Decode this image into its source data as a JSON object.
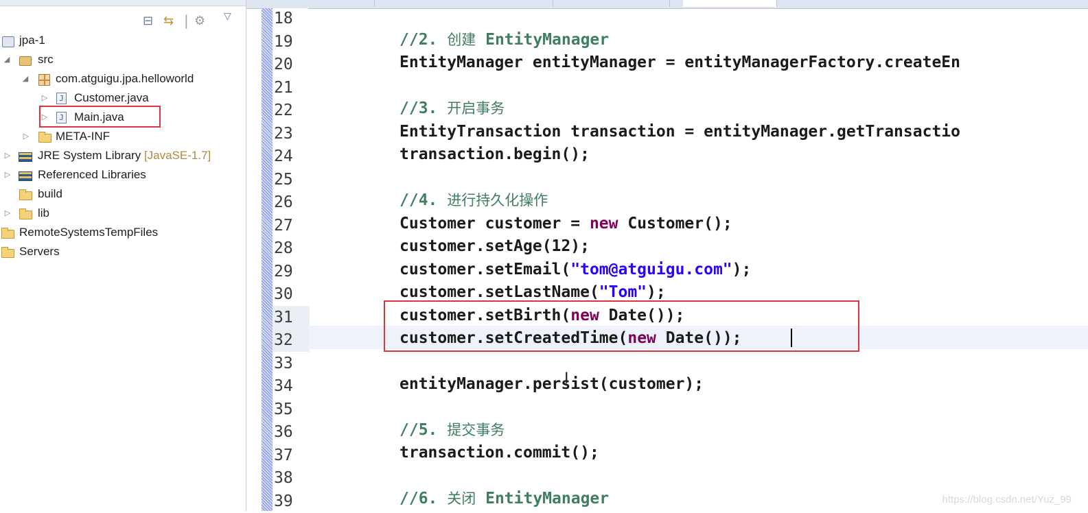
{
  "explorer": {
    "tree": [
      {
        "label": "jpa-1",
        "decoration": "",
        "icon": "project-icon"
      },
      {
        "label": "src",
        "decoration": "",
        "icon": "source-folder-icon"
      },
      {
        "label": "com.atguigu.jpa.helloworld",
        "decoration": "",
        "icon": "package-icon"
      },
      {
        "label": "Customer.java",
        "decoration": "",
        "icon": "java-file-icon"
      },
      {
        "label": "Main.java",
        "decoration": "",
        "icon": "java-file-icon"
      },
      {
        "label": "META-INF",
        "decoration": "",
        "icon": "folder-icon"
      },
      {
        "label": "JRE System Library",
        "decoration": "[JavaSE-1.7]",
        "icon": "library-icon"
      },
      {
        "label": "Referenced Libraries",
        "decoration": "",
        "icon": "library-icon"
      },
      {
        "label": "build",
        "decoration": "",
        "icon": "folder-icon"
      },
      {
        "label": "lib",
        "decoration": "",
        "icon": "folder-icon"
      },
      {
        "label": "RemoteSystemsTempFiles",
        "decoration": "",
        "icon": "project-icon"
      },
      {
        "label": "Servers",
        "decoration": "",
        "icon": "project-icon"
      }
    ]
  },
  "editor": {
    "line_numbers": [
      "18",
      "19",
      "20",
      "21",
      "22",
      "23",
      "24",
      "25",
      "26",
      "27",
      "28",
      "29",
      "30",
      "31",
      "32",
      "33",
      "34",
      "35",
      "36",
      "37",
      "38",
      "39"
    ],
    "current_line": "32",
    "code": {
      "l19_prefix": "//2. ",
      "l19_cn": "创建",
      "l19_suffix": " EntityManager",
      "l20": "EntityManager entityManager = entityManagerFactory.createEn",
      "l22_prefix": "//3. ",
      "l22_cn": "开启事务",
      "l23": "EntityTransaction transaction = entityManager.getTransactio",
      "l24": "transaction.begin();",
      "l26_prefix": "//4. ",
      "l26_cn": "进行持久化操作",
      "l27_a": "Customer customer = ",
      "l27_kw": "new",
      "l27_b": " Customer();",
      "l28": "customer.setAge(12);",
      "l29_a": "customer.setEmail(",
      "l29_str": "\"tom@atguigu.com\"",
      "l29_b": ");",
      "l30_a": "customer.setLastName(",
      "l30_str": "\"Tom\"",
      "l30_b": ");",
      "l31_a": "customer.setBirth(",
      "l31_kw": "new",
      "l31_b": " Date());",
      "l32_a": "customer.setCreatedTime(",
      "l32_kw": "new",
      "l32_b": " Date());",
      "l34": "entityManager.persist(customer);",
      "l36_prefix": "//5. ",
      "l36_cn": "提交事务",
      "l37": "transaction.commit();",
      "l39_prefix": "//6. ",
      "l39_cn": "关闭",
      "l39_suffix": " EntityManager"
    }
  },
  "watermark": "https://blog.csdn.net/Yuz_99",
  "colors": {
    "keyword": "#7f0055",
    "string": "#2a00ff",
    "comment": "#3f7f5f",
    "highlight_border": "#e0323a"
  }
}
